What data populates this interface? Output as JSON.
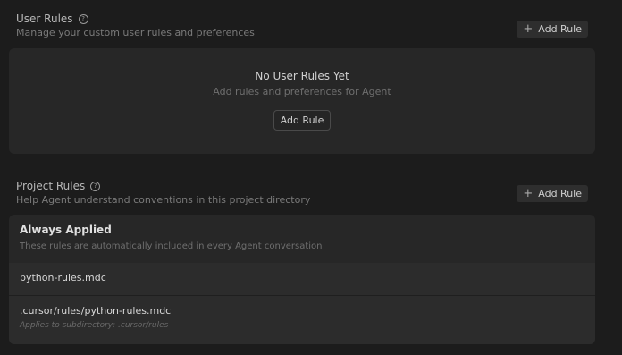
{
  "user_rules": {
    "title": "User Rules",
    "subtitle": "Manage your custom user rules and preferences",
    "add_button": "Add Rule",
    "empty_title": "No User Rules Yet",
    "empty_subtitle": "Add rules and preferences for Agent",
    "empty_button": "Add Rule"
  },
  "project_rules": {
    "title": "Project Rules",
    "subtitle": "Help Agent understand conventions in this project directory",
    "add_button": "Add Rule",
    "always_applied": {
      "title": "Always Applied",
      "subtitle": "These rules are automatically included in every Agent conversation"
    },
    "rules": [
      {
        "name": "python-rules.mdc"
      },
      {
        "name": ".cursor/rules/python-rules.mdc",
        "applies_to": "Applies to subdirectory: .cursor/rules"
      }
    ]
  },
  "icons": {
    "help": "help-circle-icon",
    "add": "plus-icon"
  }
}
